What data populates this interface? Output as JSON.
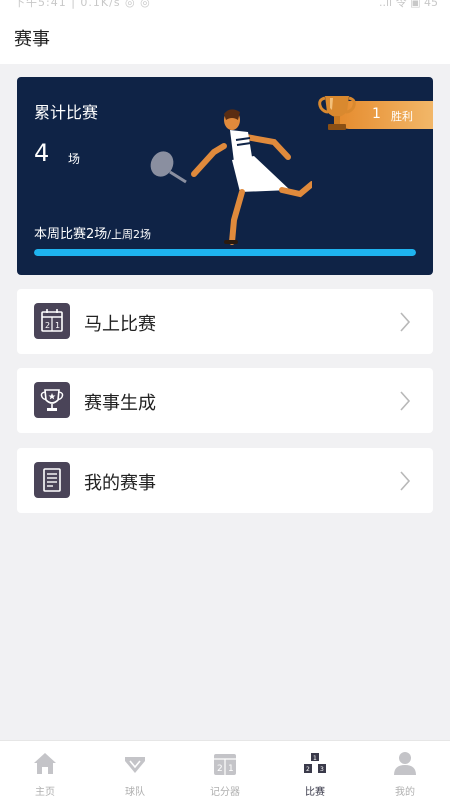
{
  "status_bar": {
    "left": "下午5:41 | 0.1K/s ◎ ◎",
    "right": "..ıl 令 ▣ 45"
  },
  "header": {
    "title": "赛事"
  },
  "stats": {
    "label": "累计比赛",
    "count": "4",
    "unit": "场",
    "weekly_main": "本周比赛2场",
    "weekly_sub": "/上周2场",
    "progress": 1.0,
    "wins_count": "1",
    "wins_label": "胜利",
    "colors": {
      "card_bg": "#0f2346",
      "progress": "#1eb3ef",
      "wins_pill": "#e58a2c"
    }
  },
  "menu": [
    {
      "label": "马上比赛",
      "icon": "scoreboard-icon"
    },
    {
      "label": "赛事生成",
      "icon": "trophy-icon"
    },
    {
      "label": "我的赛事",
      "icon": "document-icon"
    }
  ],
  "tabs": [
    {
      "label": "主页",
      "icon": "home-icon",
      "active": false
    },
    {
      "label": "球队",
      "icon": "diamond-icon",
      "active": false
    },
    {
      "label": "记分器",
      "icon": "scoreboard-icon",
      "active": false
    },
    {
      "label": "比赛",
      "icon": "podium-icon",
      "active": true
    },
    {
      "label": "我的",
      "icon": "user-icon",
      "active": false
    }
  ]
}
